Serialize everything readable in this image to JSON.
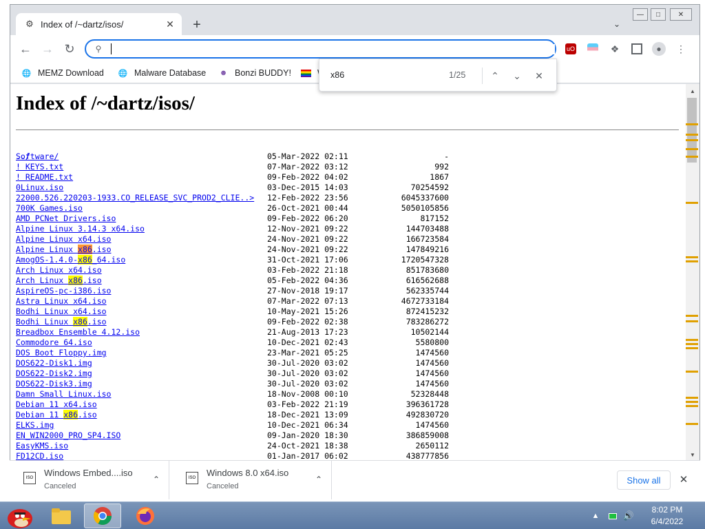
{
  "browser": {
    "tab_title": "Index of /~dartz/isos/",
    "omnibox_value": "",
    "bookmarks": [
      {
        "label": "MEMZ Download",
        "icon": "globe-icon"
      },
      {
        "label": "Malware Database",
        "icon": "globe-icon"
      },
      {
        "label": "Bonzi BUDDY!",
        "icon": "bonzi-icon"
      },
      {
        "label": "W",
        "icon": "rainbow-flag-icon"
      }
    ]
  },
  "findbar": {
    "query": "x86",
    "count": "1/25"
  },
  "page": {
    "heading": "Index of /~dartz/isos/",
    "parent_link": "../",
    "rows": [
      {
        "name": "Software/",
        "date": "05-Mar-2022 02:11",
        "size": "-"
      },
      {
        "name": "! KEYS.txt",
        "date": "07-Mar-2022 03:12",
        "size": "992"
      },
      {
        "name": "! README.txt",
        "date": "09-Feb-2022 04:02",
        "size": "1867"
      },
      {
        "name": "0Linux.iso",
        "date": "03-Dec-2015 14:03",
        "size": "70254592"
      },
      {
        "name": "22000.526.220203-1933.CO_RELEASE_SVC_PROD2_CLIE..>",
        "date": "12-Feb-2022 23:56",
        "size": "6045337600"
      },
      {
        "name": "700K Games.iso",
        "date": "26-Oct-2021 00:44",
        "size": "5050105856"
      },
      {
        "name": "AMD PCNet Drivers.iso",
        "date": "09-Feb-2022 06:20",
        "size": "817152"
      },
      {
        "name": "Alpine Linux 3.14.3 x64.iso",
        "date": "12-Nov-2021 09:22",
        "size": "144703488"
      },
      {
        "name": "Alpine Linux x64.iso",
        "date": "24-Nov-2021 09:22",
        "size": "166723584"
      },
      {
        "name_pre": "Alpine Linux ",
        "name_hl": "x86",
        "name_post": ".iso",
        "hl_active": true,
        "date": "24-Nov-2021 09:22",
        "size": "147849216"
      },
      {
        "name_pre": "AmogOS-1.4.0-",
        "name_hl": "x86",
        "name_post": "_64.iso",
        "date": "31-Oct-2021 17:06",
        "size": "1720547328"
      },
      {
        "name": "Arch Linux x64.iso",
        "date": "03-Feb-2022 21:18",
        "size": "851783680"
      },
      {
        "name_pre": "Arch Linux ",
        "name_hl": "x86",
        "name_post": ".iso",
        "date": "05-Feb-2022 04:36",
        "size": "616562688"
      },
      {
        "name": "AspireOS-pc-i386.iso",
        "date": "27-Nov-2018 19:17",
        "size": "562335744"
      },
      {
        "name": "Astra Linux x64.iso",
        "date": "07-Mar-2022 07:13",
        "size": "4672733184"
      },
      {
        "name": "Bodhi Linux x64.iso",
        "date": "10-May-2021 15:26",
        "size": "872415232"
      },
      {
        "name_pre": "Bodhi Linux ",
        "name_hl": "x86",
        "name_post": ".iso",
        "date": "09-Feb-2022 02:38",
        "size": "783286272"
      },
      {
        "name": "Breadbox Ensemble 4.12.iso",
        "date": "21-Aug-2013 17:23",
        "size": "10502144"
      },
      {
        "name": "Commodore 64.iso",
        "date": "10-Dec-2021 02:43",
        "size": "5580800"
      },
      {
        "name": "DOS Boot Floppy.img",
        "date": "23-Mar-2021 05:25",
        "size": "1474560"
      },
      {
        "name": "DOS622-Disk1.img",
        "date": "30-Jul-2020 03:02",
        "size": "1474560"
      },
      {
        "name": "DOS622-Disk2.img",
        "date": "30-Jul-2020 03:02",
        "size": "1474560"
      },
      {
        "name": "DOS622-Disk3.img",
        "date": "30-Jul-2020 03:02",
        "size": "1474560"
      },
      {
        "name": "Damn Small Linux.iso",
        "date": "18-Nov-2008 00:10",
        "size": "52328448"
      },
      {
        "name": "Debian 11 x64.iso",
        "date": "03-Feb-2022 21:19",
        "size": "396361728"
      },
      {
        "name_pre": "Debian 11 ",
        "name_hl": "x86",
        "name_post": ".iso",
        "date": "18-Dec-2021 13:09",
        "size": "492830720"
      },
      {
        "name": "ELKS.img",
        "date": "10-Dec-2021 06:34",
        "size": "1474560"
      },
      {
        "name": "EN_WIN2000_PRO_SP4.ISO",
        "date": "09-Jan-2020 18:30",
        "size": "386859008"
      },
      {
        "name": "EasyKMS.iso",
        "date": "24-Oct-2021 18:38",
        "size": "2650112"
      },
      {
        "name": "FD12CD.iso",
        "date": "01-Jan-2017 06:02",
        "size": "438777856"
      }
    ]
  },
  "downloads": {
    "items": [
      {
        "name": "Windows Embed....iso",
        "status": "Canceled"
      },
      {
        "name": "Windows 8.0 x64.iso",
        "status": "Canceled"
      }
    ],
    "show_all": "Show all"
  },
  "taskbar": {
    "time": "8:02 PM",
    "date": "6/4/2022"
  },
  "colors": {
    "accent": "#1a73e8",
    "link": "#0000ee",
    "find_highlight": "#ffff00",
    "find_active": "#ff9632",
    "taskbar": "#6a87b0"
  }
}
